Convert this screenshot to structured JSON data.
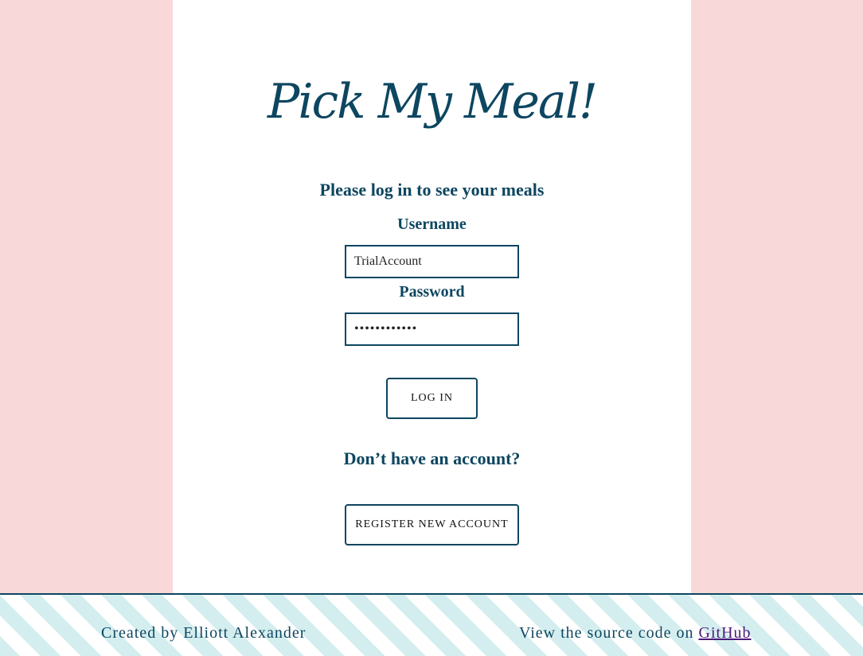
{
  "app": {
    "title": "Pick My Meal!"
  },
  "login": {
    "prompt": "Please log in to see your meals",
    "username_label": "Username",
    "username_value": "TrialAccount",
    "password_label": "Password",
    "password_value": "••••••••••••",
    "login_button": "LOG IN",
    "no_account_text": "Don’t have an account?",
    "register_button": "REGISTER NEW ACCOUNT"
  },
  "footer": {
    "credit": "Created by Elliott Alexander",
    "source_prefix": "View the source code on ",
    "source_link": "GitHub"
  },
  "colors": {
    "primary": "#0d4660",
    "side_background": "#f8d8d8",
    "footer_stripe": "#d4eeef",
    "link": "#4a1a7a"
  }
}
